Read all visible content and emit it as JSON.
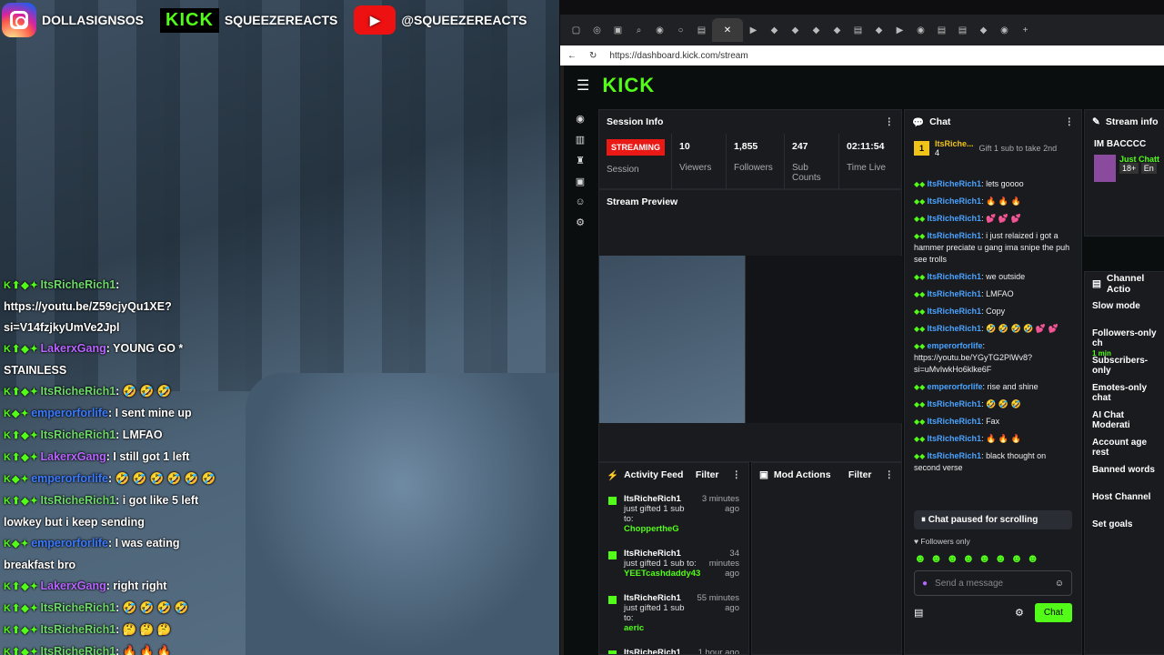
{
  "socials": {
    "instagram": "DOLLASIGNSOS",
    "kick_label": "KICK",
    "kick": "SQUEEZEREACTS",
    "youtube": "@SQUEEZEREACTS"
  },
  "overlay_chat": [
    {
      "badges": "K ⬆ ◆ ✦",
      "user": "ItsRicheRich1",
      "color": "#6fd86a",
      "text": ": https://youtu.be/Z59cjyQu1XE?si=V14fzjkyUmVe2Jpl"
    },
    {
      "badges": "K ⬆ ◆ ✦",
      "user": "LakerxGang",
      "color": "#b766ff",
      "text": ": YOUNG GO * STAINLESS"
    },
    {
      "badges": "K ⬆ ◆ ✦",
      "user": "ItsRicheRich1",
      "color": "#6fd86a",
      "text": ": 🤣 🤣 🤣"
    },
    {
      "badges": "K ◆ ✦",
      "user": "emperorforlife",
      "color": "#3b7bff",
      "text": ": I sent mine up"
    },
    {
      "badges": "K ⬆ ◆ ✦",
      "user": "ItsRicheRich1",
      "color": "#6fd86a",
      "text": ": LMFAO"
    },
    {
      "badges": "K ⬆ ◆ ✦",
      "user": "LakerxGang",
      "color": "#b766ff",
      "text": ": I still got 1 left"
    },
    {
      "badges": "K ◆ ✦",
      "user": "emperorforlife",
      "color": "#3b7bff",
      "text": ": 🤣 🤣 🤣 🤣 🤣 🤣"
    },
    {
      "badges": "K ⬆ ◆ ✦",
      "user": "ItsRicheRich1",
      "color": "#6fd86a",
      "text": ": i got like 5 left lowkey but i keep sending"
    },
    {
      "badges": "K ◆ ✦",
      "user": "emperorforlife",
      "color": "#3b7bff",
      "text": ": I was eating breakfast bro"
    },
    {
      "badges": "K ⬆ ◆ ✦",
      "user": "LakerxGang",
      "color": "#b766ff",
      "text": ": right right"
    },
    {
      "badges": "K ⬆ ◆ ✦",
      "user": "ItsRicheRich1",
      "color": "#6fd86a",
      "text": ": 🤣 🤣 🤣 🤣"
    },
    {
      "badges": "K ⬆ ◆ ✦",
      "user": "ItsRicheRich1",
      "color": "#6fd86a",
      "text": ": 🤔 🤔 🤔"
    },
    {
      "badges": "K ⬆ ◆ ✦",
      "user": "ItsRicheRich1",
      "color": "#6fd86a",
      "text": ": 🔥 🔥 🔥"
    }
  ],
  "browser": {
    "url": "https://dashboard.kick.com/stream"
  },
  "app": {
    "logo": "KICK"
  },
  "session": {
    "title": "Session Info",
    "live": "STREAMING",
    "session_label": "Session",
    "viewers": "10",
    "viewers_label": "Viewers",
    "followers": "1,855",
    "followers_label": "Followers",
    "subs": "247",
    "subs_label": "Sub Counts",
    "time": "02:11:54",
    "time_label": "Time Live"
  },
  "preview": {
    "title": "Stream Preview"
  },
  "activity": {
    "title": "Activity Feed",
    "filter": "Filter",
    "items": [
      {
        "user": "ItsRicheRich1",
        "time": "3 minutes ago",
        "text": "just gifted 1 sub to:",
        "target": "ChoppertheG"
      },
      {
        "user": "ItsRicheRich1",
        "time": "34 minutes ago",
        "text": "just gifted 1 sub to:",
        "target": "YEETcashdaddy43"
      },
      {
        "user": "ItsRicheRich1",
        "time": "55 minutes ago",
        "text": "just gifted 1 sub to:",
        "target": "aeric"
      },
      {
        "user": "ItsRicheRich1",
        "time": "1 hour ago",
        "text": "",
        "target": ""
      }
    ]
  },
  "mod": {
    "title": "Mod Actions",
    "filter": "Filter"
  },
  "chat": {
    "title": "Chat",
    "top_user": "ItsRiche...",
    "top_count": "4",
    "gift": "Gift 1 sub to take 2nd",
    "paused": "Chat paused for scrolling",
    "followers_only": "Followers only",
    "placeholder": "Send a message",
    "send": "Chat",
    "messages": [
      {
        "user": "ItsRicheRich1",
        "text": ": lets goooo"
      },
      {
        "user": "ItsRicheRich1",
        "text": ": 🔥 🔥 🔥"
      },
      {
        "user": "ItsRicheRich1",
        "text": ": 💕 💕 💕"
      },
      {
        "user": "ItsRicheRich1",
        "text": ": i just relaized i got a hammer preciate u gang ima snipe the puh see trolls"
      },
      {
        "user": "ItsRicheRich1",
        "text": ": we outside"
      },
      {
        "user": "ItsRicheRich1",
        "text": ": LMFAO"
      },
      {
        "user": "ItsRicheRich1",
        "text": ": Copy"
      },
      {
        "user": "ItsRicheRich1",
        "text": ": 🤣 🤣 🤣 🤣 💕 💕"
      },
      {
        "user": "emperorforlife",
        "text": ": https://youtu.be/YGyTG2PlWv8?si=uMvIwkHo6klke6F"
      },
      {
        "user": "emperorforlife",
        "text": ": rise and shine"
      },
      {
        "user": "ItsRicheRich1",
        "text": ": 🤣 🤣 🤣"
      },
      {
        "user": "ItsRicheRich1",
        "text": ": Fax"
      },
      {
        "user": "ItsRicheRich1",
        "text": ": 🔥 🔥 🔥"
      },
      {
        "user": "ItsRicheRich1",
        "text": ": black thought on second verse"
      }
    ]
  },
  "stream_info": {
    "title": "Stream info",
    "name": "IM BACCCC",
    "category": "Just Chatt",
    "tag1": "18+",
    "tag2": "En"
  },
  "channel_actions": {
    "title": "Channel Actio",
    "items": [
      "Slow mode",
      "Followers-only ch",
      "Subscribers-only",
      "Emotes-only chat",
      "AI Chat Moderati",
      "Account age rest",
      "Banned words",
      "Host Channel",
      "Set goals"
    ],
    "followers_sub": "1 min"
  }
}
